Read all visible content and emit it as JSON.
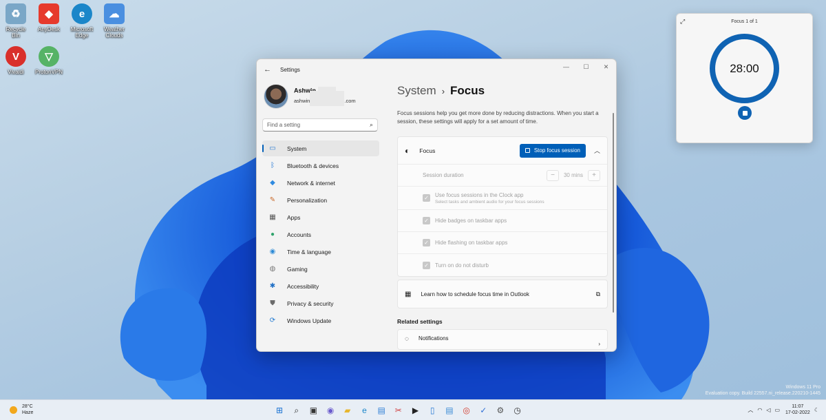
{
  "desktop": {
    "icons": [
      {
        "label": "Recycle Bin",
        "color": "#7aa7c7",
        "glyph": "♻"
      },
      {
        "label": "AnyDesk",
        "color": "#e63a2d",
        "glyph": "◆"
      },
      {
        "label": "Microsoft Edge",
        "color": "#1b86c9",
        "glyph": "e"
      },
      {
        "label": "Weather Clouds",
        "color": "#4a8fe0",
        "glyph": "☁"
      },
      {
        "label": "Vivaldi",
        "color": "#d9302b",
        "glyph": "V"
      },
      {
        "label": "ProtonVPN",
        "color": "#56b366",
        "glyph": "▽"
      }
    ],
    "watermark_line1": "Windows 11 Pro",
    "watermark_line2": "Evaluation copy. Build 22557.ni_release.220210-1445"
  },
  "settings": {
    "window_title": "Settings",
    "profile": {
      "name": "Ashwin",
      "email_prefix": "ashwin",
      "email_suffix": ".com"
    },
    "search_placeholder": "Find a setting",
    "nav": [
      {
        "label": "System",
        "icon": "system-icon",
        "glyph": "▭",
        "color": "#2b7bd3"
      },
      {
        "label": "Bluetooth & devices",
        "icon": "bluetooth-icon",
        "glyph": "ᛒ",
        "color": "#1d74d4"
      },
      {
        "label": "Network & internet",
        "icon": "wifi-icon",
        "glyph": "◆",
        "color": "#2f8ae0"
      },
      {
        "label": "Personalization",
        "icon": "brush-icon",
        "glyph": "✎",
        "color": "#c96a2b"
      },
      {
        "label": "Apps",
        "icon": "apps-icon",
        "glyph": "▦",
        "color": "#555"
      },
      {
        "label": "Accounts",
        "icon": "accounts-icon",
        "glyph": "●",
        "color": "#2fa36b"
      },
      {
        "label": "Time & language",
        "icon": "globe-icon",
        "glyph": "◉",
        "color": "#2b8ad6"
      },
      {
        "label": "Gaming",
        "icon": "gamepad-icon",
        "glyph": "◍",
        "color": "#777"
      },
      {
        "label": "Accessibility",
        "icon": "accessibility-icon",
        "glyph": "✱",
        "color": "#1f6fc5"
      },
      {
        "label": "Privacy & security",
        "icon": "shield-icon",
        "glyph": "⛊",
        "color": "#6b6b6b"
      },
      {
        "label": "Windows Update",
        "icon": "update-icon",
        "glyph": "⟳",
        "color": "#1f78d1"
      }
    ],
    "breadcrumb": {
      "parent": "System",
      "separator": "›",
      "current": "Focus"
    },
    "description": "Focus sessions help you get more done by reducing distractions. When you start a session, these settings will apply for a set amount of time.",
    "focus": {
      "label": "Focus",
      "stop_button": "Stop focus session",
      "session_duration_label": "Session duration",
      "session_duration_value": "30 mins",
      "options": [
        {
          "label": "Use focus sessions in the Clock app",
          "sub": "Select tasks and ambient audio for your focus sessions"
        },
        {
          "label": "Hide badges on taskbar apps",
          "sub": ""
        },
        {
          "label": "Hide flashing on taskbar apps",
          "sub": ""
        },
        {
          "label": "Turn on do not disturb",
          "sub": ""
        }
      ]
    },
    "learn_link": "Learn how to schedule focus time in Outlook",
    "related_heading": "Related settings",
    "notifications_label": "Notifications"
  },
  "focus_widget": {
    "title": "Focus 1 of 1",
    "time": "28:00"
  },
  "taskbar": {
    "weather_temp": "28°C",
    "weather_cond": "Haze",
    "apps": [
      {
        "name": "start-icon",
        "glyph": "⊞",
        "color": "#1670d1"
      },
      {
        "name": "search-icon",
        "glyph": "⌕",
        "color": "#222"
      },
      {
        "name": "task-view-icon",
        "glyph": "▣",
        "color": "#333"
      },
      {
        "name": "chat-icon",
        "glyph": "◉",
        "color": "#6a5acd"
      },
      {
        "name": "file-explorer-icon",
        "glyph": "▰",
        "color": "#e7b62e"
      },
      {
        "name": "edge-icon",
        "glyph": "e",
        "color": "#1b86c9"
      },
      {
        "name": "store-icon",
        "glyph": "▤",
        "color": "#2f7fd6"
      },
      {
        "name": "snipping-icon",
        "glyph": "✂",
        "color": "#d04040"
      },
      {
        "name": "media-icon",
        "glyph": "▶",
        "color": "#222"
      },
      {
        "name": "phone-icon",
        "glyph": "▯",
        "color": "#2a7bd4"
      },
      {
        "name": "notepad-icon",
        "glyph": "▤",
        "color": "#3a8bd6"
      },
      {
        "name": "chrome-icon",
        "glyph": "◎",
        "color": "#d33b2c"
      },
      {
        "name": "todo-icon",
        "glyph": "✓",
        "color": "#2f6fd6"
      },
      {
        "name": "settings-icon",
        "glyph": "⚙",
        "color": "#555"
      },
      {
        "name": "clock-app-icon",
        "glyph": "◷",
        "color": "#333"
      }
    ],
    "time": "11:07",
    "date": "17-02-2022"
  }
}
